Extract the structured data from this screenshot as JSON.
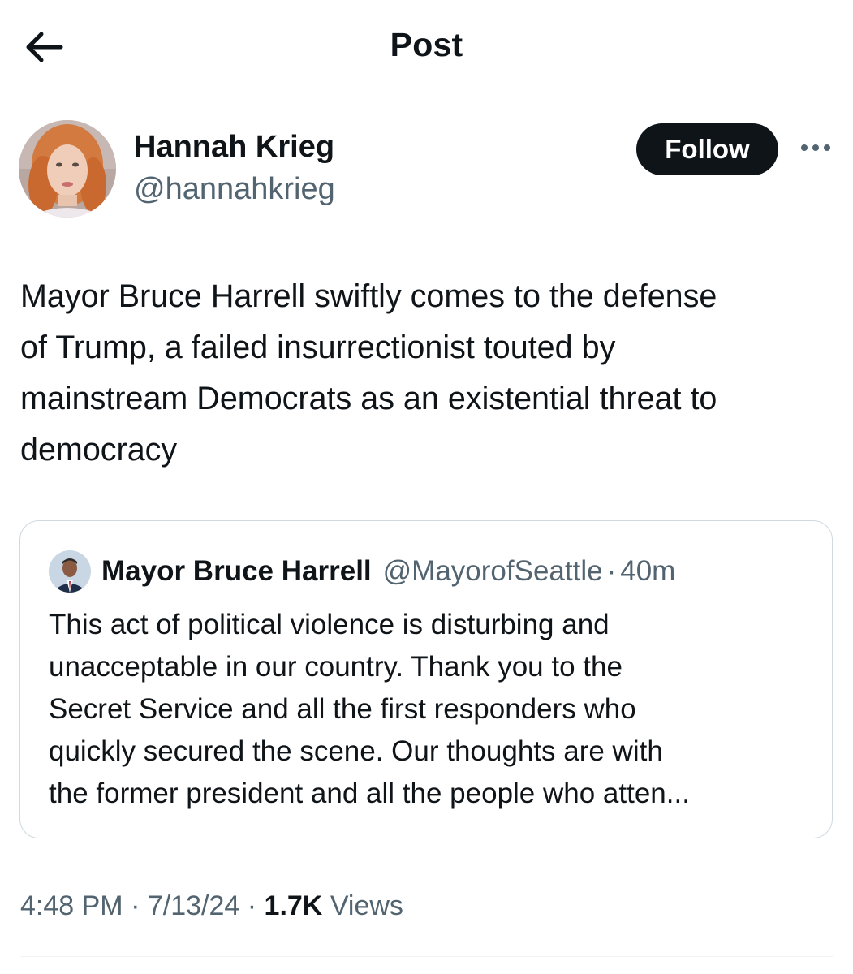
{
  "header": {
    "title": "Post",
    "back_icon": "arrow-left-icon"
  },
  "author": {
    "name": "Hannah Krieg",
    "handle": "@hannahkrieg",
    "follow_label": "Follow",
    "more_icon": "more-horizontal-icon"
  },
  "post": {
    "text": "Mayor Bruce Harrell swiftly comes to the defense\nof Trump, a failed insurrectionist touted by\nmainstream Democrats as an existential threat to\ndemocracy"
  },
  "quote": {
    "name": "Mayor Bruce Harrell",
    "handle": "@MayorofSeattle",
    "separator": "·",
    "time": "40m",
    "text": "This act of political violence is disturbing and\nunacceptable in our country. Thank you to the\nSecret Service and all the first responders who\nquickly secured the scene. Our thoughts are with\nthe former president and all the people who atten..."
  },
  "meta": {
    "time": "4:48 PM",
    "separator": "·",
    "date": "7/13/24",
    "views_count": "1.7K",
    "views_label": "Views"
  },
  "colors": {
    "text_primary": "#0f1419",
    "text_secondary": "#536471",
    "border": "#cfd9de",
    "button_bg": "#0f1419",
    "button_text": "#ffffff"
  }
}
